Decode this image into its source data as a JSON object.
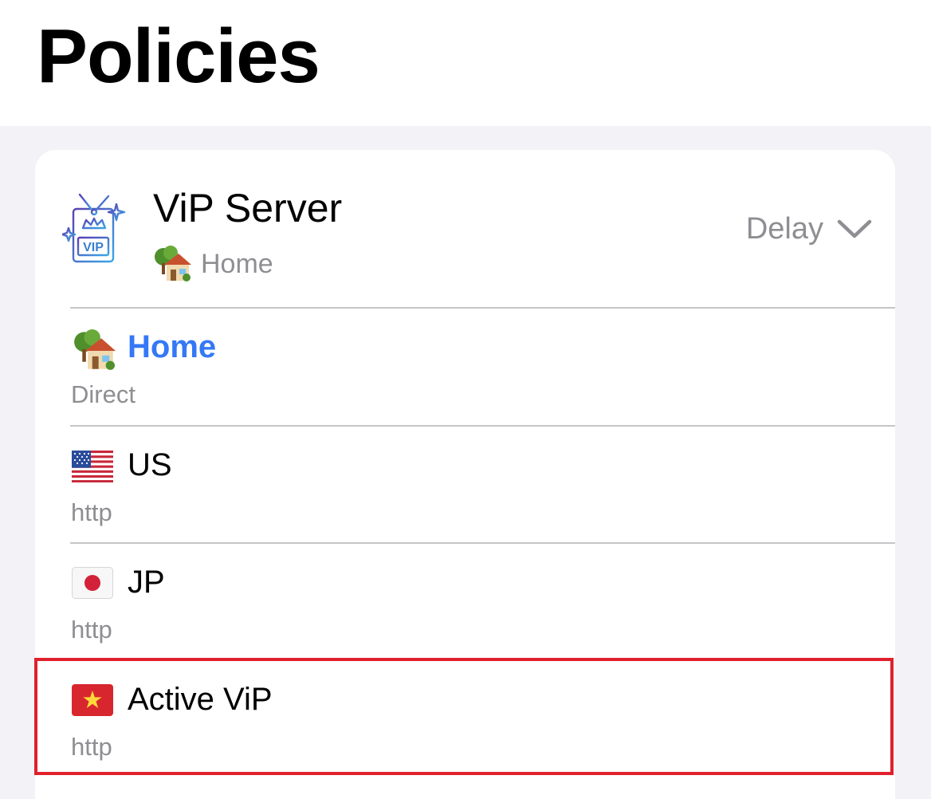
{
  "page": {
    "title": "Policies"
  },
  "group": {
    "name": "ViP Server",
    "selected_label": "Home",
    "selected_icon": "house-with-garden-emoji",
    "icon": "vip-tv-icon",
    "mode_label": "Delay",
    "expand_icon": "chevron-down-icon"
  },
  "policies": [
    {
      "name": "Home",
      "type": "Direct",
      "icon": "house-with-garden-emoji",
      "selected": true
    },
    {
      "name": "US",
      "type": "http",
      "icon": "us-flag-icon",
      "selected": false
    },
    {
      "name": "JP",
      "type": "http",
      "icon": "japan-flag-icon",
      "selected": false
    },
    {
      "name": "Active ViP",
      "type": "http",
      "icon": "vietnam-flag-icon",
      "selected": false
    }
  ],
  "colors": {
    "accent": "#3478f6",
    "secondary_text": "#8e8e93",
    "background": "#f2f2f7",
    "highlight": "#e0202c"
  }
}
